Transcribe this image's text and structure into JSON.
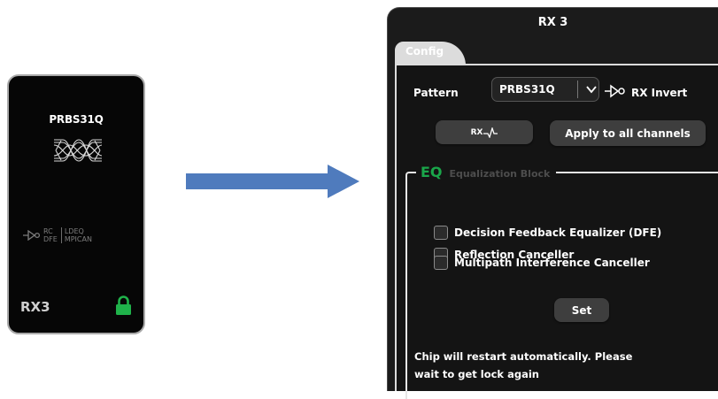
{
  "card": {
    "pattern": "PRBS31Q",
    "features": {
      "col1": [
        "RC",
        "DFE"
      ],
      "col2": [
        "LDEQ",
        "MPICAN"
      ]
    },
    "channel_name": "RX3",
    "lock_color": "#1fb24a"
  },
  "arrow_color": "#4f7bbd",
  "panel": {
    "title": "RX 3",
    "tab": "Config",
    "pattern_label": "Pattern",
    "pattern_value": "PRBS31Q",
    "rx_invert_label": "RX Invert",
    "rx_button_label": "RX",
    "apply_all_label": "Apply to all channels",
    "eq": {
      "abbr": "EQ",
      "title": "Equalization Block",
      "options": [
        {
          "label": "Decision Feedback Equalizer (DFE)",
          "checked": false
        },
        {
          "label": "Reflection Canceller",
          "checked": false
        },
        {
          "label": "Multipath Interference Canceller",
          "checked": false
        }
      ]
    },
    "set_label": "Set",
    "note_lines": [
      "Chip will restart automatically. Please",
      "wait to get lock again"
    ]
  }
}
